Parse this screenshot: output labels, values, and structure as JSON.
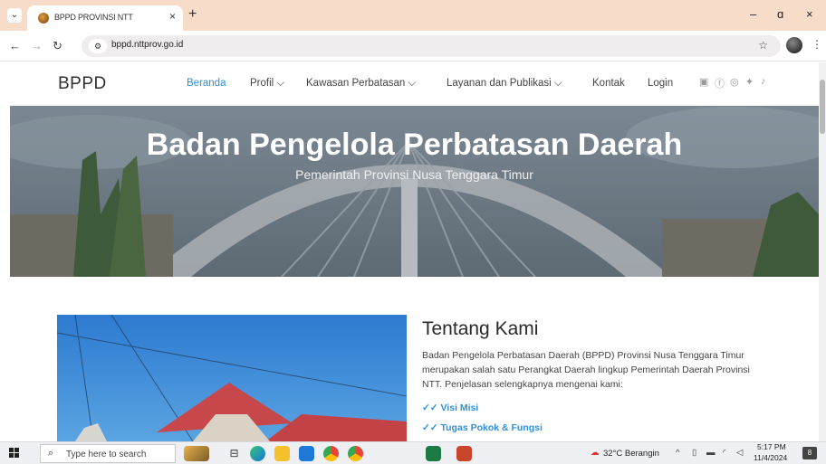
{
  "browser": {
    "tab_title": "BPPD PROVINSI NTT",
    "tab_close": "×",
    "new_tab": "+",
    "url": "bppd.nttprov.go.id",
    "window_controls": {
      "minimize": "–",
      "maximize": "ɑ",
      "close": "×"
    }
  },
  "site": {
    "brand": "BPPD",
    "nav": [
      {
        "label": "Beranda",
        "active": true
      },
      {
        "label": "Profil ⌵"
      },
      {
        "label": "Kawasan Perbatasan ⌵"
      },
      {
        "label": "Layanan dan Publikasi ⌵"
      },
      {
        "label": "Kontak"
      },
      {
        "label": "Login"
      }
    ],
    "social_icons": [
      "youtube-icon",
      "facebook-icon",
      "instagram-icon",
      "twitter-icon",
      "tiktok-icon"
    ]
  },
  "hero": {
    "title": "Badan Pengelola Perbatasan Daerah",
    "subtitle": "Pemerintah Provinsi Nusa Tenggara Timur"
  },
  "about": {
    "title": "Tentang Kami",
    "text": "Badan Pengelola Perbatasan Daerah (BPPD) Provinsi Nusa Tenggara Timur merupakan salah satu Perangkat Daerah lingkup Pemerintah Daerah Provinsi NTT. Penjelasan selengkapnya mengenai kami:",
    "links": [
      "✓✓ Visi Misi",
      "✓✓ Tugas Pokok & Fungsi"
    ]
  },
  "taskbar": {
    "search_placeholder": "Type here to search",
    "weather": "32°C  Berangin",
    "time": "5:17 PM",
    "date": "11/4/2024",
    "notification_count": "8"
  },
  "colors": {
    "accent": "#2f8fd8",
    "tab_bar": "#f7dcc9"
  }
}
